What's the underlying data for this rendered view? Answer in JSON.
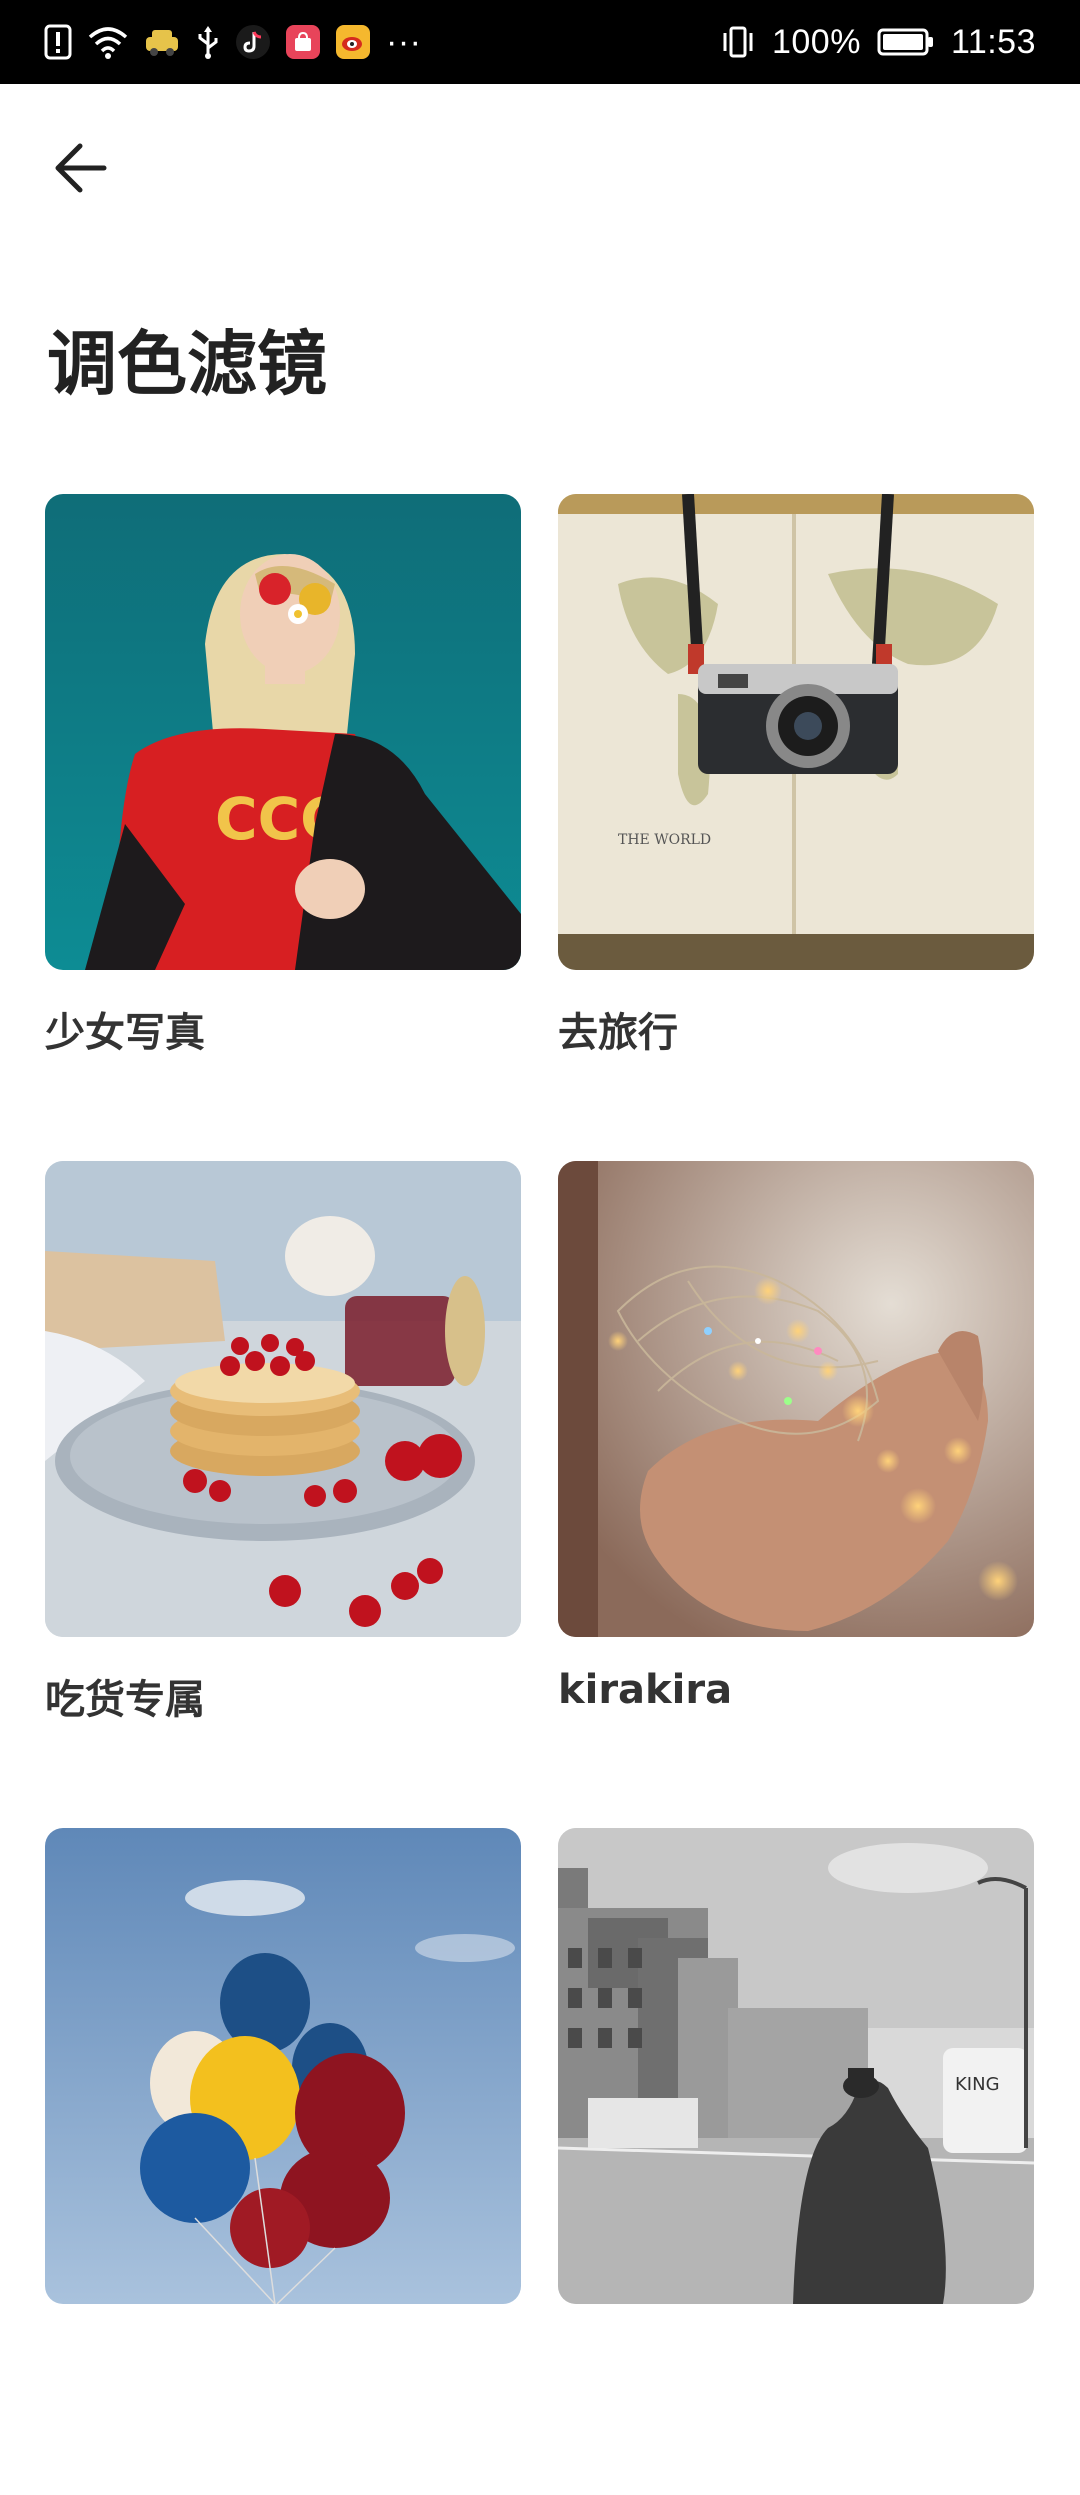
{
  "status_bar": {
    "battery": "100%",
    "time": "11:53",
    "more": "···",
    "app_icons": [
      "alert-icon",
      "wifi-icon",
      "taxi-app-icon",
      "usb-icon",
      "tiktok-app-icon",
      "shopping-app-icon",
      "weibo-app-icon"
    ]
  },
  "header": {
    "title": "调色滤镜"
  },
  "filters": [
    {
      "label": "少女写真",
      "image": "girl-with-sunglasses-photo"
    },
    {
      "label": "去旅行",
      "image": "camera-on-map-photo"
    },
    {
      "label": "吃货专属",
      "image": "pancakes-with-cherries-photo"
    },
    {
      "label": "kirakira",
      "image": "fairy-lights-in-hand-photo"
    },
    {
      "label": "",
      "image": "balloons-sky-photo"
    },
    {
      "label": "",
      "image": "street-black-white-photo"
    }
  ],
  "colors": {
    "status_bar_bg": "#000000",
    "background": "#ffffff",
    "title_text": "#222222"
  }
}
